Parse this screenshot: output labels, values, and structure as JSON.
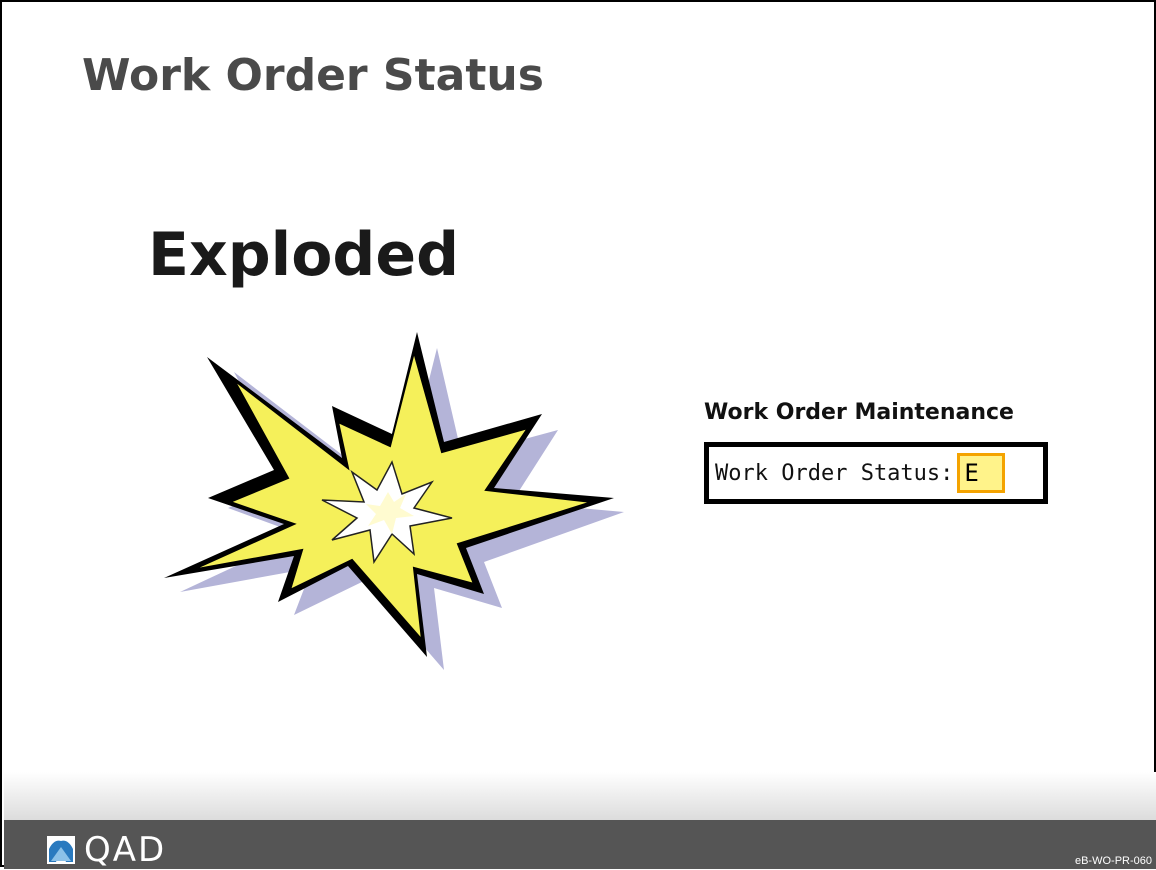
{
  "slide": {
    "title": "Work Order Status",
    "status_heading": "Exploded"
  },
  "form": {
    "caption": "Work Order Maintenance",
    "field_label": "Work Order Status:",
    "field_value": "E"
  },
  "footer": {
    "logo_text": "QAD",
    "doc_code": "eB-WO-PR-060"
  },
  "icons": {
    "burst": "explosion-burst-icon",
    "logo": "qad-logo-icon"
  },
  "colors": {
    "title": "#4a4a4a",
    "footer_bar": "#555555",
    "burst_fill": "#f5f05a",
    "burst_shadow": "#b4b4d8",
    "field_highlight": "#fff38a",
    "field_highlight_border": "#f4a300"
  }
}
